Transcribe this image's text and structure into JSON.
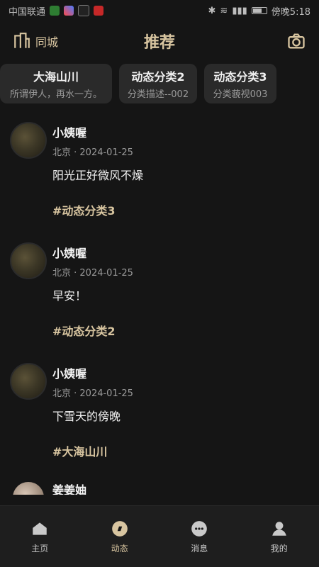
{
  "status_bar": {
    "left_text": "中国联通",
    "right_text": "傍晚5:18"
  },
  "header": {
    "city_label": "同城",
    "title": "推荐"
  },
  "categories": [
    {
      "title": "大海山川",
      "desc": "所谓伊人，再水一方。"
    },
    {
      "title": "动态分类2",
      "desc": "分类描述--002"
    },
    {
      "title": "动态分类3",
      "desc": "分类藐视003"
    }
  ],
  "posts": [
    {
      "name": "小姨喔",
      "meta": "北京 · 2024-01-25",
      "content": "阳光正好微风不燥",
      "tag": "#动态分类3"
    },
    {
      "name": "小姨喔",
      "meta": "北京 · 2024-01-25",
      "content": "早安！",
      "tag": "#动态分类2"
    },
    {
      "name": "小姨喔",
      "meta": "北京 · 2024-01-25",
      "content": "下雪天的傍晚",
      "tag": "#大海山川"
    }
  ],
  "partial_post": {
    "name": "姜姜妯"
  },
  "tabbar": {
    "items": [
      {
        "label": "主页",
        "icon": "home-icon"
      },
      {
        "label": "动态",
        "icon": "compass-icon"
      },
      {
        "label": "消息",
        "icon": "chat-icon"
      },
      {
        "label": "我的",
        "icon": "user-icon"
      }
    ],
    "active_index": 1,
    "colors": {
      "accent": "#d8c5a0",
      "inactive": "#c9c9c9"
    }
  }
}
